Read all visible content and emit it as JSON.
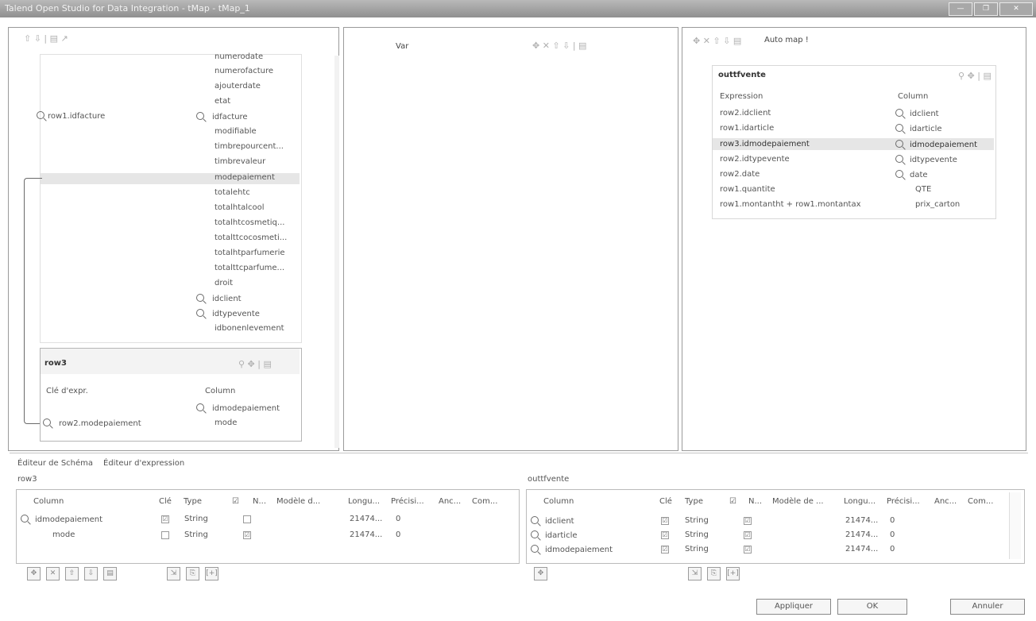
{
  "window": {
    "title": "Talend Open Studio for Data Integration - tMap - tMap_1",
    "buttons": [
      "—",
      "❐",
      "✕"
    ]
  },
  "left": {
    "toolbar": "⇧ ⇩ | ▤ ↗",
    "main_row": "row1.idfacture",
    "main_columns": [
      "numerodate",
      "numerofacture",
      "ajouterdate",
      "etat",
      "idfacture",
      "modifiable",
      "timbrepourcent...",
      "timbrevaleur",
      "modepaiement",
      "totalehtc",
      "totalhtalcool",
      "totalhtcosmetiq...",
      "totalttcocosmeti...",
      "totalhtparfumerie",
      "totalttcparfume...",
      "droit",
      "idclient",
      "idtypevente",
      "idbonenlevement"
    ],
    "lookup": {
      "name": "row3",
      "expr_header": "Clé d'expr.",
      "col_header": "Column",
      "expr": "row2.modepaiement",
      "columns": [
        "idmodepaiement",
        "mode"
      ],
      "icons": "⚲ ✥ | ▤"
    }
  },
  "var": {
    "title": "Var",
    "toolbar": "✥ ✕ ⇧ ⇩ | ▤"
  },
  "right": {
    "toolbar": "✥ ✕ ⇧ ⇩ ▤",
    "automap": "Auto map !",
    "output": {
      "name": "outtfvente",
      "expr_header": "Expression",
      "col_header": "Column",
      "icons": "⚲ ✥ | ▤",
      "rows": [
        {
          "expr": "row2.idclient",
          "col": "idclient"
        },
        {
          "expr": "row1.idarticle",
          "col": "idarticle"
        },
        {
          "expr": "row3.idmodepaiement",
          "col": "idmodepaiement"
        },
        {
          "expr": "row2.idtypevente",
          "col": "idtypevente"
        },
        {
          "expr": "row2.date",
          "col": "date"
        },
        {
          "expr": "row1.quantite",
          "col": "QTE"
        },
        {
          "expr": "row1.montantht + row1.montantax",
          "col": "prix_carton"
        }
      ]
    }
  },
  "bottom": {
    "tabs": [
      "Éditeur de Schéma",
      "Éditeur d'expression"
    ],
    "left": {
      "name": "row3",
      "headers": [
        "Column",
        "Clé",
        "Type",
        "☑",
        "N...",
        "Modèle d...",
        "Longu...",
        "Précisi...",
        "Anc...",
        "Com..."
      ],
      "rows": [
        {
          "col": "idmodepaiement",
          "key": "☑",
          "type": "String",
          "nul": "",
          "len": "21474...",
          "prec": "0"
        },
        {
          "col": "mode",
          "key": "",
          "type": "String",
          "nul": "☑",
          "len": "21474...",
          "prec": "0"
        }
      ]
    },
    "right": {
      "name": "outtfvente",
      "headers": [
        "Column",
        "Clé",
        "Type",
        "☑",
        "N...",
        "Modèle de ...",
        "Longu...",
        "Précisi...",
        "Anc...",
        "Com..."
      ],
      "rows": [
        {
          "col": "idclient",
          "key": "☑",
          "type": "String",
          "nul": "☑",
          "len": "21474...",
          "prec": "0"
        },
        {
          "col": "idarticle",
          "key": "☑",
          "type": "String",
          "nul": "☑",
          "len": "21474...",
          "prec": "0"
        },
        {
          "col": "idmodepaiement",
          "key": "☑",
          "type": "String",
          "nul": "☑",
          "len": "21474...",
          "prec": "0"
        }
      ]
    },
    "left_tools": [
      "✥",
      "✕",
      "⇧",
      "⇩",
      "▤",
      "⇲",
      "⎘",
      "[+]"
    ],
    "right_tools": [
      "✥",
      "⇲",
      "⎘",
      "[+]"
    ]
  },
  "footer": {
    "apply": "Appliquer",
    "ok": "OK",
    "cancel": "Annuler"
  }
}
